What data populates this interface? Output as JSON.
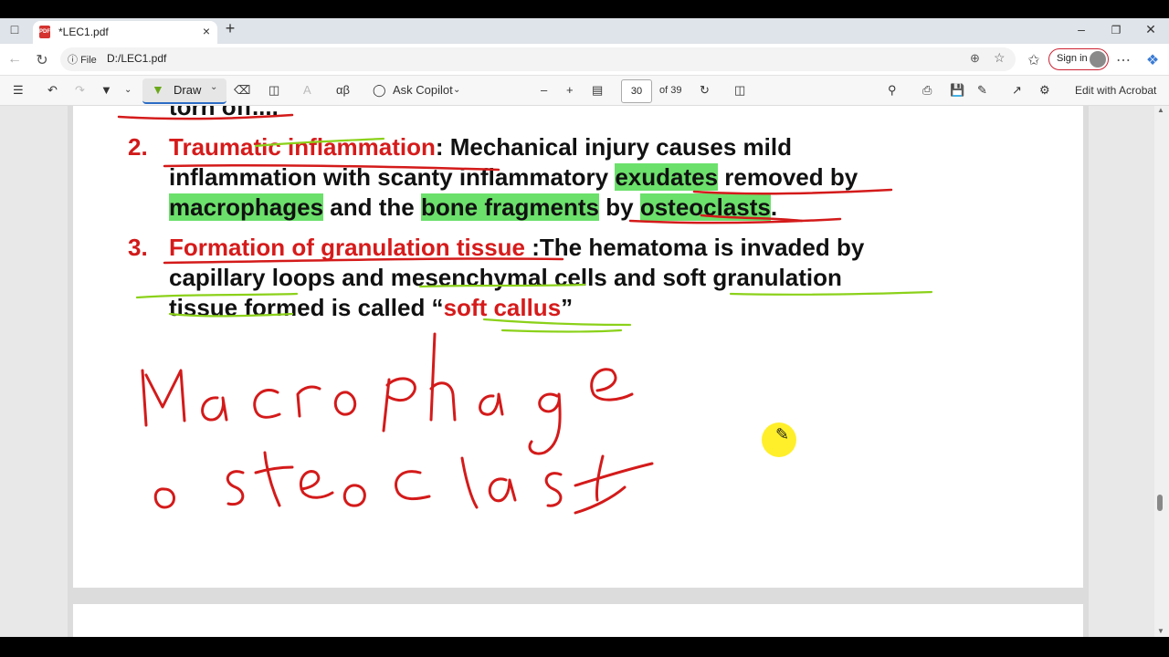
{
  "browser": {
    "tab_title": "*LEC1.pdf",
    "tab_icon_label": "PDF",
    "address_prefix": "File",
    "address": "D:/LEC1.pdf",
    "signin_label": "Sign in"
  },
  "toolbar": {
    "draw_label": "Draw",
    "copilot_label": "Ask Copilot",
    "page_number": "30",
    "page_total": "of 39",
    "edit_label": "Edit with Acrobat"
  },
  "doc": {
    "partial_line": "torn off....",
    "item2_num": "2.",
    "item2_head": "Traumatic inflammation",
    "item2_l1_rest": ": Mechanical injury causes mild",
    "item2_l2_a": "inflammation with scanty inflammatory ",
    "item2_l2_hl": "exudates",
    "item2_l2_b": " removed by",
    "item2_l3_hl1": "macrophages",
    "item2_l3_a": " and the ",
    "item2_l3_hl2": "bone fragments",
    "item2_l3_b": " by ",
    "item2_l3_hl3": "osteoclasts",
    "item2_l3_c": ".",
    "item3_num": "3.",
    "item3_head": "Formation of granulation tissue",
    "item3_l1_rest": " :The hematoma is invaded by",
    "item3_l2": "capillary loops and mesenchymal cells and soft granulation",
    "item3_l3_a": "tissue formed is called “",
    "item3_l3_red": "soft callus",
    "item3_l3_b": "”",
    "handwriting_1": "Macrophage",
    "handwriting_2": "osteoclast"
  },
  "colors": {
    "ink_red": "#d41a1a",
    "ink_green": "#8bd11a",
    "highlight": "#6be06b",
    "heading_red": "#d61b1b"
  }
}
